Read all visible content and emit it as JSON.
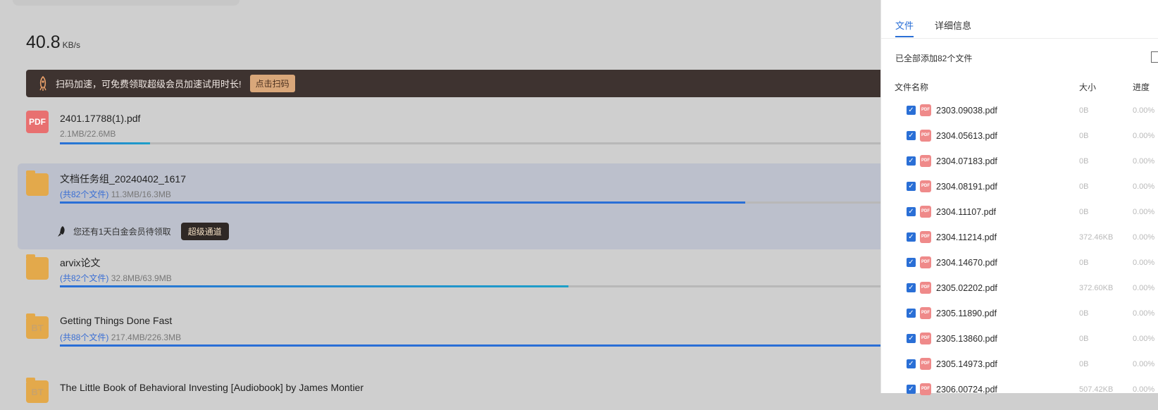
{
  "speed": {
    "value": "40.8",
    "unit": "KB/s"
  },
  "promo": {
    "text": "扫码加速，可免费领取超级会员加速试用时长!",
    "button": "点击扫码"
  },
  "tasks": [
    {
      "name": "2401.17788(1).pdf",
      "count": "",
      "size": "2.1MB/22.6MB",
      "progress": 0.11
    },
    {
      "name": "文档任务组_20240402_1617",
      "count": "(共82个文件)",
      "size": "11.3MB/16.3MB",
      "progress": 0.835
    },
    {
      "name": "arvix论文",
      "count": "(共82个文件)",
      "size": "32.8MB/63.9MB",
      "progress": 0.62
    },
    {
      "name": "Getting Things Done Fast",
      "count": "(共88个文件)",
      "size": "217.4MB/226.3MB",
      "progress": 1.0
    },
    {
      "name": "The Little Book of Behavioral Investing [Audiobook] by James Montier",
      "count": "",
      "size": "",
      "progress": 0
    }
  ],
  "icons": {
    "pdf": "PDF",
    "bt": "BT"
  },
  "vip": {
    "text": "您还有1天白金会员待领取",
    "button": "超级通道"
  },
  "panel": {
    "tabs": [
      "文件",
      "详细信息"
    ],
    "summary": "已全部添加82个文件",
    "headers": {
      "name": "文件名称",
      "size": "大小",
      "progress": "进度"
    },
    "file_icon": "PDF",
    "files": [
      {
        "name": "2303.09038.pdf",
        "size": "0B",
        "progress": "0.00%"
      },
      {
        "name": "2304.05613.pdf",
        "size": "0B",
        "progress": "0.00%"
      },
      {
        "name": "2304.07183.pdf",
        "size": "0B",
        "progress": "0.00%"
      },
      {
        "name": "2304.08191.pdf",
        "size": "0B",
        "progress": "0.00%"
      },
      {
        "name": "2304.11107.pdf",
        "size": "0B",
        "progress": "0.00%"
      },
      {
        "name": "2304.11214.pdf",
        "size": "372.46KB",
        "progress": "0.00%"
      },
      {
        "name": "2304.14670.pdf",
        "size": "0B",
        "progress": "0.00%"
      },
      {
        "name": "2305.02202.pdf",
        "size": "372.60KB",
        "progress": "0.00%"
      },
      {
        "name": "2305.11890.pdf",
        "size": "0B",
        "progress": "0.00%"
      },
      {
        "name": "2305.13860.pdf",
        "size": "0B",
        "progress": "0.00%"
      },
      {
        "name": "2305.14973.pdf",
        "size": "0B",
        "progress": "0.00%"
      },
      {
        "name": "2306.00724.pdf",
        "size": "507.42KB",
        "progress": "0.00%"
      }
    ]
  },
  "colors": {
    "accent": "#2a6fd6",
    "promo_bg": "#3e3330",
    "folder": "#e3a94b",
    "pdf": "#e87070"
  }
}
